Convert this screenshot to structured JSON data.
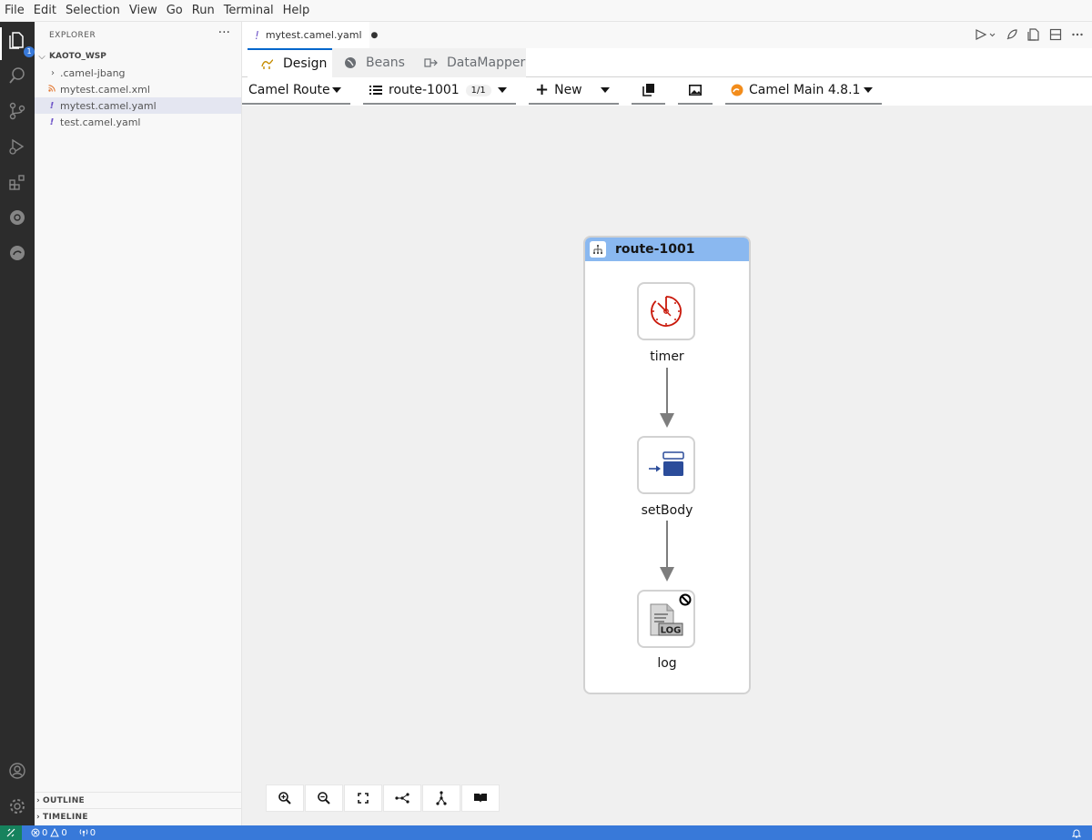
{
  "menu": [
    "File",
    "Edit",
    "Selection",
    "View",
    "Go",
    "Run",
    "Terminal",
    "Help"
  ],
  "activity": {
    "icons": [
      "explorer-icon",
      "search-icon",
      "source-control-icon",
      "run-debug-icon",
      "extensions-icon",
      "kubernetes-icon",
      "camel-icon",
      "account-icon",
      "manage-gear-icon"
    ],
    "badge": "1"
  },
  "sidebar": {
    "title": "EXPLORER",
    "more": "···",
    "workspace": "KAOTO_WSP",
    "items": [
      {
        "label": ".camel-jbang",
        "kind": "folder"
      },
      {
        "label": "mytest.camel.xml",
        "kind": "xml"
      },
      {
        "label": "mytest.camel.yaml",
        "kind": "yaml",
        "selected": true
      },
      {
        "label": "test.camel.yaml",
        "kind": "yaml"
      }
    ],
    "outline": "OUTLINE",
    "timeline": "TIMELINE"
  },
  "editor": {
    "tab_label": "mytest.camel.yaml",
    "tab_bang": "!",
    "tab_dirty": "●"
  },
  "viewtabs": [
    "Design",
    "Beans",
    "DataMapper"
  ],
  "toolbar": {
    "type_select": "Camel Route",
    "route_select": "route-1001",
    "route_count": "1/1",
    "new_label": "New",
    "runtime": "Camel Main 4.8.1"
  },
  "canvas": {
    "route_label": "route-1001",
    "nodes": [
      "timer",
      "setBody",
      "log"
    ],
    "controls": [
      "zoom-in-icon",
      "zoom-out-icon",
      "fit-to-screen-icon",
      "horizontal-layout-icon",
      "vertical-layout-icon",
      "legend-book-icon"
    ]
  },
  "status": {
    "errors": "0",
    "warnings": "0",
    "ports": "0"
  },
  "colors": {
    "accent": "#0066cc",
    "statusbar": "#3879d9",
    "route_header": "#8ab8f0",
    "timer_red": "#c9190b",
    "setbody_blue": "#2b4c9a"
  }
}
